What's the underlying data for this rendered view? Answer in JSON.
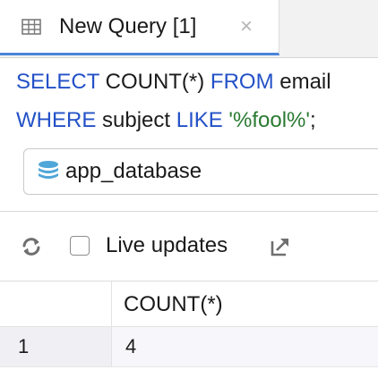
{
  "tab": {
    "title": "New Query [1]",
    "close": "×",
    "icon": "table-icon"
  },
  "editor": {
    "lines": [
      {
        "kw1": "SELECT",
        "t1": " COUNT(*) ",
        "kw2": "FROM",
        "t2": " email"
      },
      {
        "kw1": "WHERE",
        "t1": " subject ",
        "kw2": "LIKE",
        "str": " '%fool%'",
        "t2": ";"
      }
    ]
  },
  "database_selector": {
    "selected": "app_database",
    "icon": "database-icon"
  },
  "results_toolbar": {
    "refresh_icon": "refresh-icon",
    "live_updates_label": "Live updates",
    "live_updates_checked": false,
    "open_external_icon": "open-external-icon"
  },
  "results": {
    "columns": [
      "COUNT(*)"
    ],
    "rows": [
      {
        "index": "1",
        "cells": [
          "4"
        ]
      }
    ]
  },
  "colors": {
    "accent": "#4a84d9",
    "keyword": "#2351c7",
    "string": "#2a7a32",
    "database_icon": "#4fa6d8"
  }
}
